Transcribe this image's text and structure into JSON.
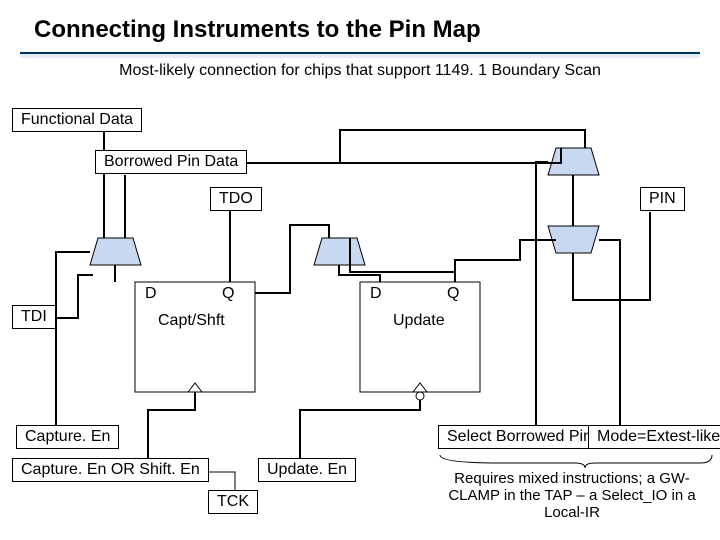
{
  "title": "Connecting Instruments to the Pin Map",
  "subtitle": "Most-likely connection for chips that support 1149. 1 Boundary Scan",
  "functional_data": "Functional Data",
  "borrowed_pin_data": "Borrowed Pin Data",
  "tdo": "TDO",
  "tdi": "TDI",
  "pin": "PIN",
  "d1": "D",
  "q1": "Q",
  "d2": "D",
  "q2": "Q",
  "capt_shft": "Capt/Shft",
  "update": "Update",
  "capture_en": "Capture. En",
  "capture_or_shift": "Capture. En OR Shift. En",
  "update_en": "Update. En",
  "tck": "TCK",
  "select_borrowed": "Select Borrowed Pin",
  "mode": "Mode=Extest-like",
  "footnote": "Requires mixed instructions; a GW-CLAMP\nin the TAP – a Select_IO in a Local-IR"
}
